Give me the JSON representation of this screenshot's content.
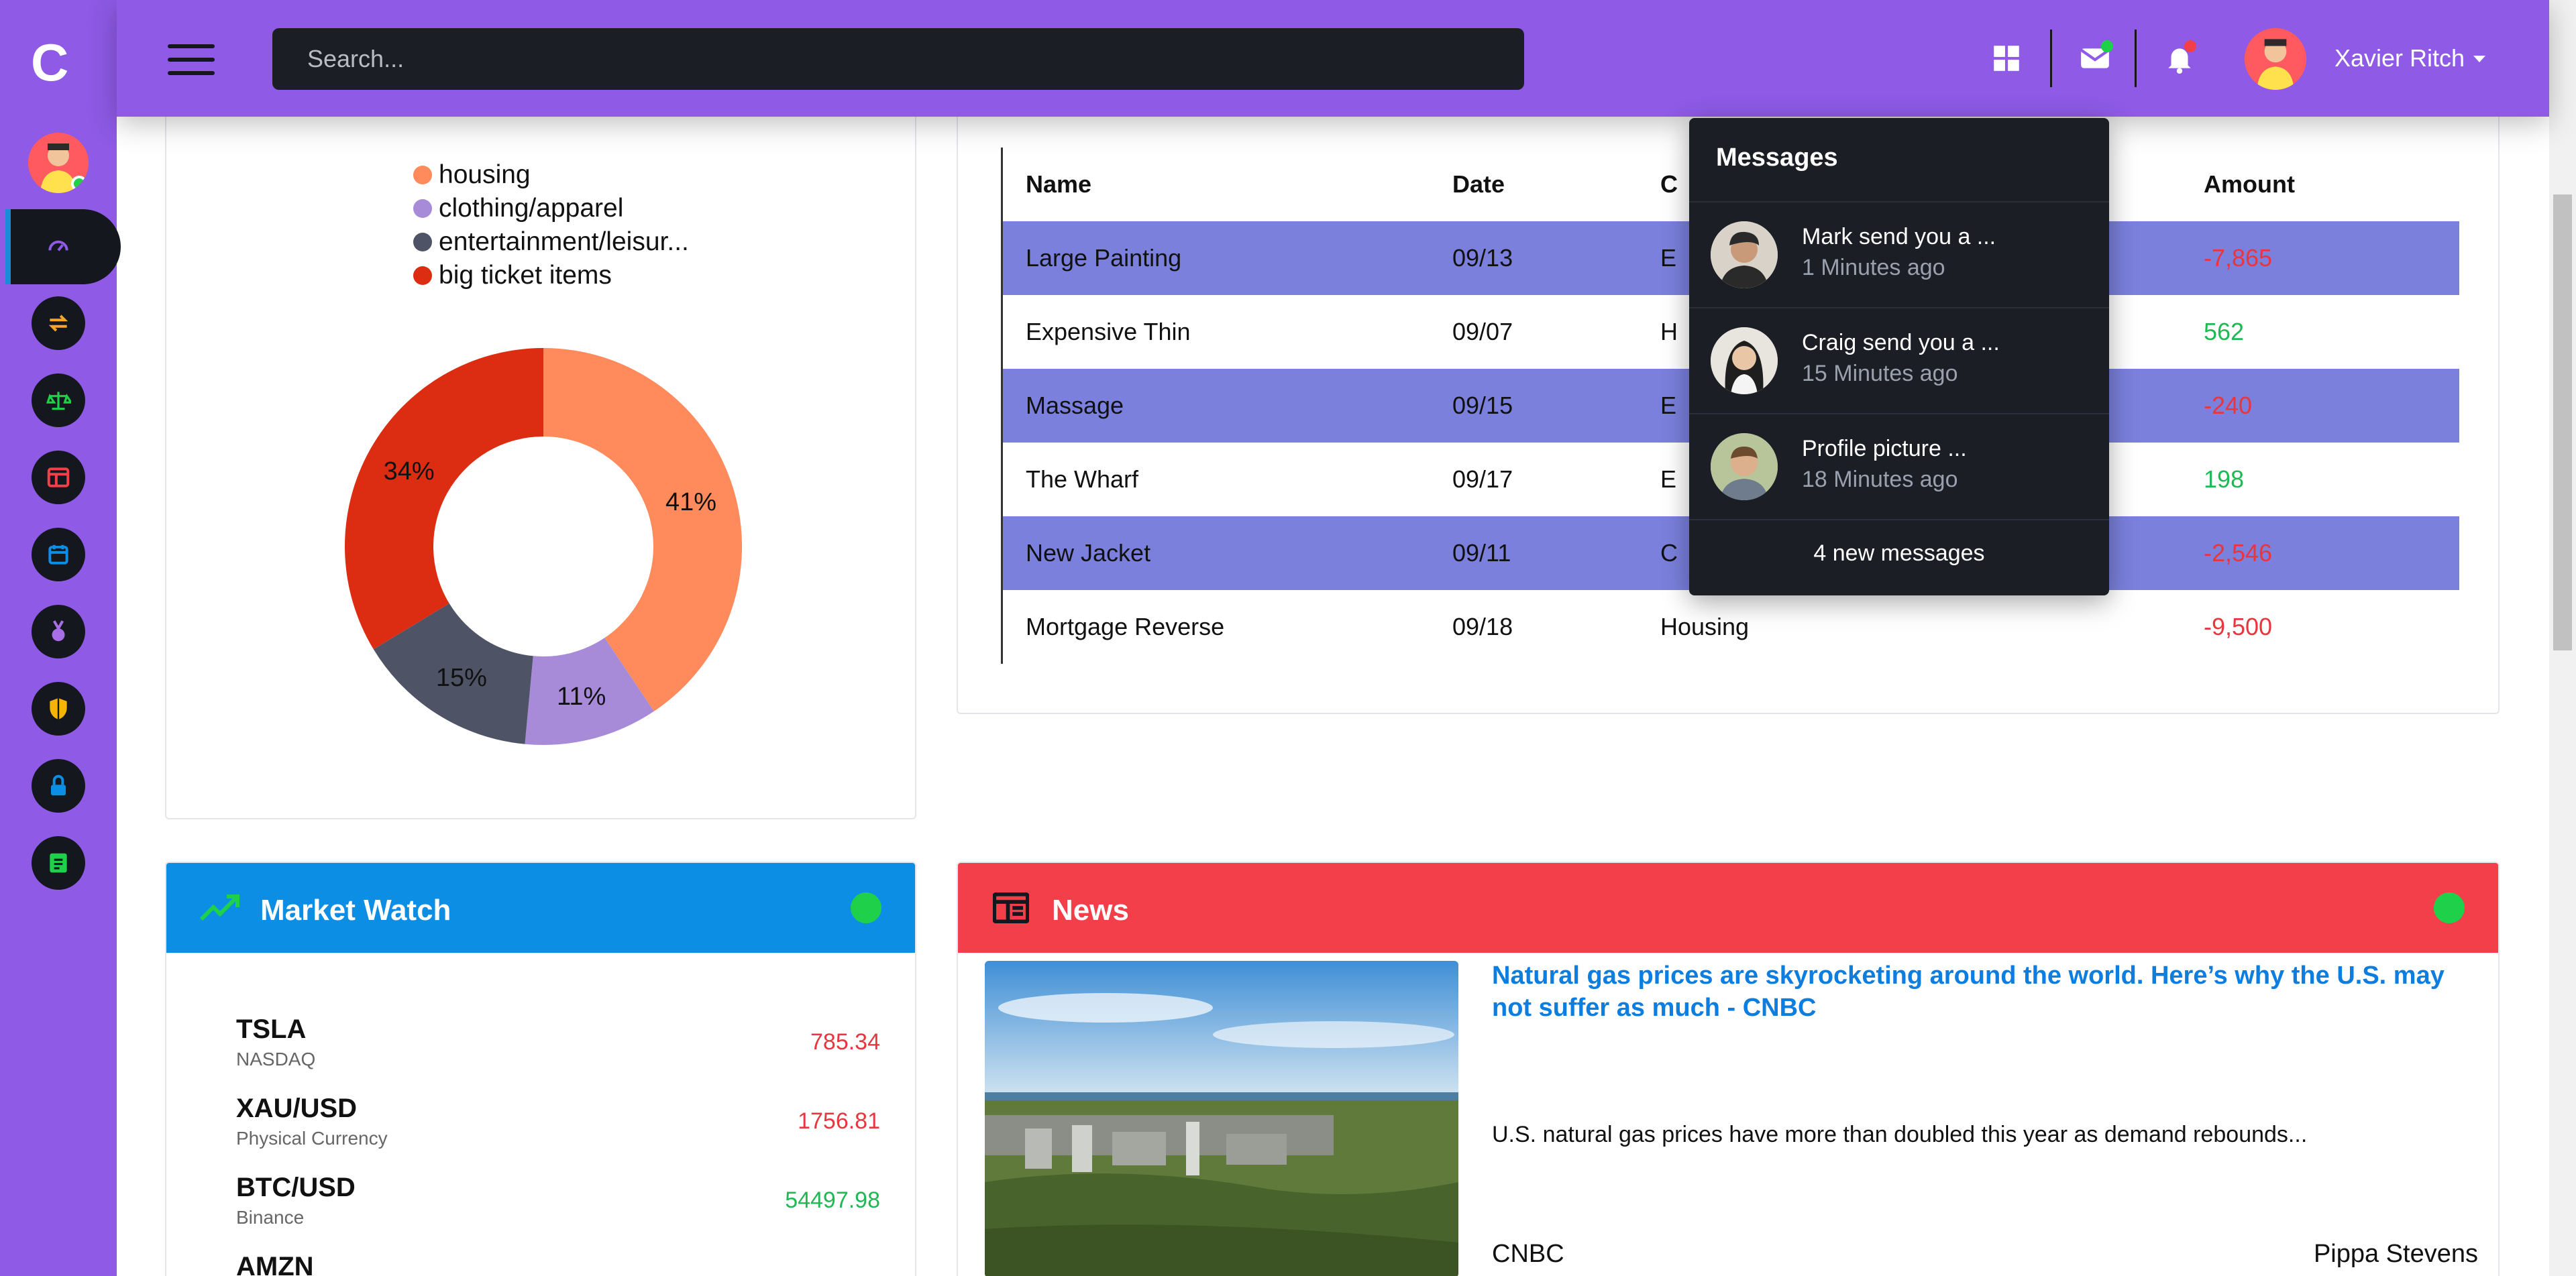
{
  "brand": {
    "logo_letter": "C"
  },
  "search": {
    "placeholder": "Search..."
  },
  "user": {
    "name": "Xavier Ritch"
  },
  "sidebar": {
    "items": [
      {
        "icon": "speedometer-icon",
        "color": "#8e5ae6",
        "active": true
      },
      {
        "icon": "transfer-arrows-icon",
        "color": "#f5a623"
      },
      {
        "icon": "scale-icon",
        "color": "#1fd14a"
      },
      {
        "icon": "browser-window-icon",
        "color": "#f33f4a"
      },
      {
        "icon": "calendar-icon",
        "color": "#0d8ee5"
      },
      {
        "icon": "medal-icon",
        "color": "#a86ee8"
      },
      {
        "icon": "shield-icon",
        "color": "#f5b400"
      },
      {
        "icon": "lock-icon",
        "color": "#0d8ee5"
      },
      {
        "icon": "note-icon",
        "color": "#1fd14a"
      }
    ]
  },
  "chart_data": {
    "type": "pie",
    "donut": true,
    "legend_position": "top",
    "categories": [
      "housing",
      "clothing/apparel",
      "entertainment/leisur...",
      "big ticket items"
    ],
    "values": [
      41,
      11,
      15,
      34
    ],
    "labels": [
      "41%",
      "11%",
      "15%",
      "34%"
    ],
    "colors": [
      "#ff8a5c",
      "#a78bd8",
      "#4e5365",
      "#dc2d12"
    ]
  },
  "transactions": {
    "headers": {
      "name": "Name",
      "date": "Date",
      "category": "C",
      "amount": "Amount"
    },
    "rows": [
      {
        "name": "Large Painting",
        "date": "09/13",
        "category": "E",
        "amount": "-7,865",
        "sign": "neg"
      },
      {
        "name": "Expensive Thin",
        "date": "09/07",
        "category": "H",
        "amount": "562",
        "sign": "pos"
      },
      {
        "name": "Massage",
        "date": "09/15",
        "category": "E",
        "amount": "-240",
        "sign": "neg"
      },
      {
        "name": "The Wharf",
        "date": "09/17",
        "category": "E",
        "amount": "198",
        "sign": "pos"
      },
      {
        "name": "New Jacket",
        "date": "09/11",
        "category": "C",
        "amount": "-2,546",
        "sign": "neg"
      },
      {
        "name": "Mortgage Reverse",
        "date": "09/18",
        "category": "Housing",
        "amount": "-9,500",
        "sign": "neg"
      }
    ]
  },
  "messages": {
    "title": "Messages",
    "items": [
      {
        "text": "Mark send you a ...",
        "time": "1 Minutes ago"
      },
      {
        "text": "Craig send you a ...",
        "time": "15 Minutes ago"
      },
      {
        "text": "Profile picture ...",
        "time": "18 Minutes ago"
      }
    ],
    "footer": "4 new messages"
  },
  "market_watch": {
    "title": "Market Watch",
    "stocks": [
      {
        "symbol": "TSLA",
        "exchange": "NASDAQ",
        "price": "785.34",
        "trend": "down"
      },
      {
        "symbol": "XAU/USD",
        "exchange": "Physical Currency",
        "price": "1756.81",
        "trend": "down"
      },
      {
        "symbol": "BTC/USD",
        "exchange": "Binance",
        "price": "54497.98",
        "trend": "up"
      },
      {
        "symbol": "AMZN",
        "exchange": "",
        "price": "",
        "trend": "down"
      }
    ]
  },
  "news": {
    "title": "News",
    "headline": "Natural gas prices are skyrocketing around the world. Here’s why the U.S. may not suffer as much - CNBC",
    "description": "U.S. natural gas prices have more than doubled this year as demand rebounds...",
    "source": "CNBC",
    "author": "Pippa Stevens"
  }
}
